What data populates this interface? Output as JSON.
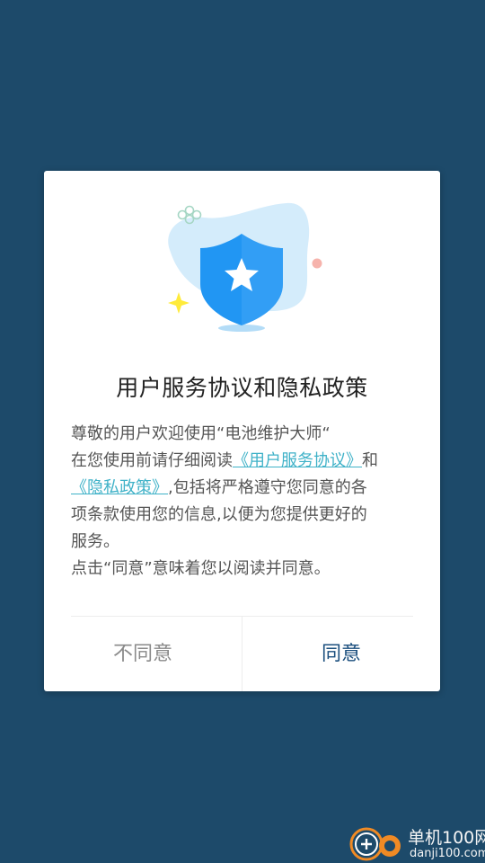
{
  "dialog": {
    "title": "用户服务协议和隐私政策",
    "body": {
      "line1": "尊敬的用户欢迎使用“电池维护大师“",
      "line2_prefix": "在您使用前请仔细阅读",
      "service_link": "《用户服务协议》",
      "line2_suffix": "和",
      "privacy_link": "《隐私政策》",
      "line3_suffix": ",包括将严格遵守您同意的各",
      "line4": "项条款使用您的信息,以便为您提供更好的",
      "line5": "服务。",
      "line6": "点击“同意”意味着您以阅读并同意。"
    },
    "buttons": {
      "disagree": "不同意",
      "agree": "同意"
    }
  },
  "watermark": {
    "name": "单机100网",
    "domain": "danji100.com"
  },
  "colors": {
    "background": "#1d4a6a",
    "link": "#40b2c8",
    "agree": "#1b4f7e",
    "shield": "#2196f3"
  }
}
